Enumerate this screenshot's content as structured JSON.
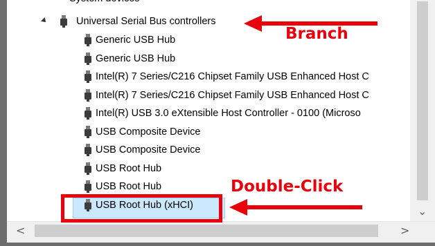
{
  "tree": {
    "partial_top_label": "System devices",
    "branch_label": "Universal Serial Bus controllers",
    "children": [
      "Generic USB Hub",
      "Generic USB Hub",
      "Intel(R) 7 Series/C216 Chipset Family USB Enhanced Host C",
      "Intel(R) 7 Series/C216 Chipset Family USB Enhanced Host C",
      "Intel(R) USB 3.0 eXtensible Host Controller - 0100 (Microso",
      "USB Composite Device",
      "USB Composite Device",
      "USB Root Hub",
      "USB Root Hub",
      "USB Root Hub (xHCI)"
    ],
    "selected_index": 9
  },
  "annotations": {
    "branch": "Branch",
    "double_click": "Double-Click",
    "color": "#e8000b"
  },
  "icons": {
    "usb": "usb-device-icon",
    "expander": "expand-collapse-icon"
  },
  "scrollbars": {
    "left_arrow": "<",
    "right_arrow": ">",
    "down_arrow": "⌄"
  }
}
